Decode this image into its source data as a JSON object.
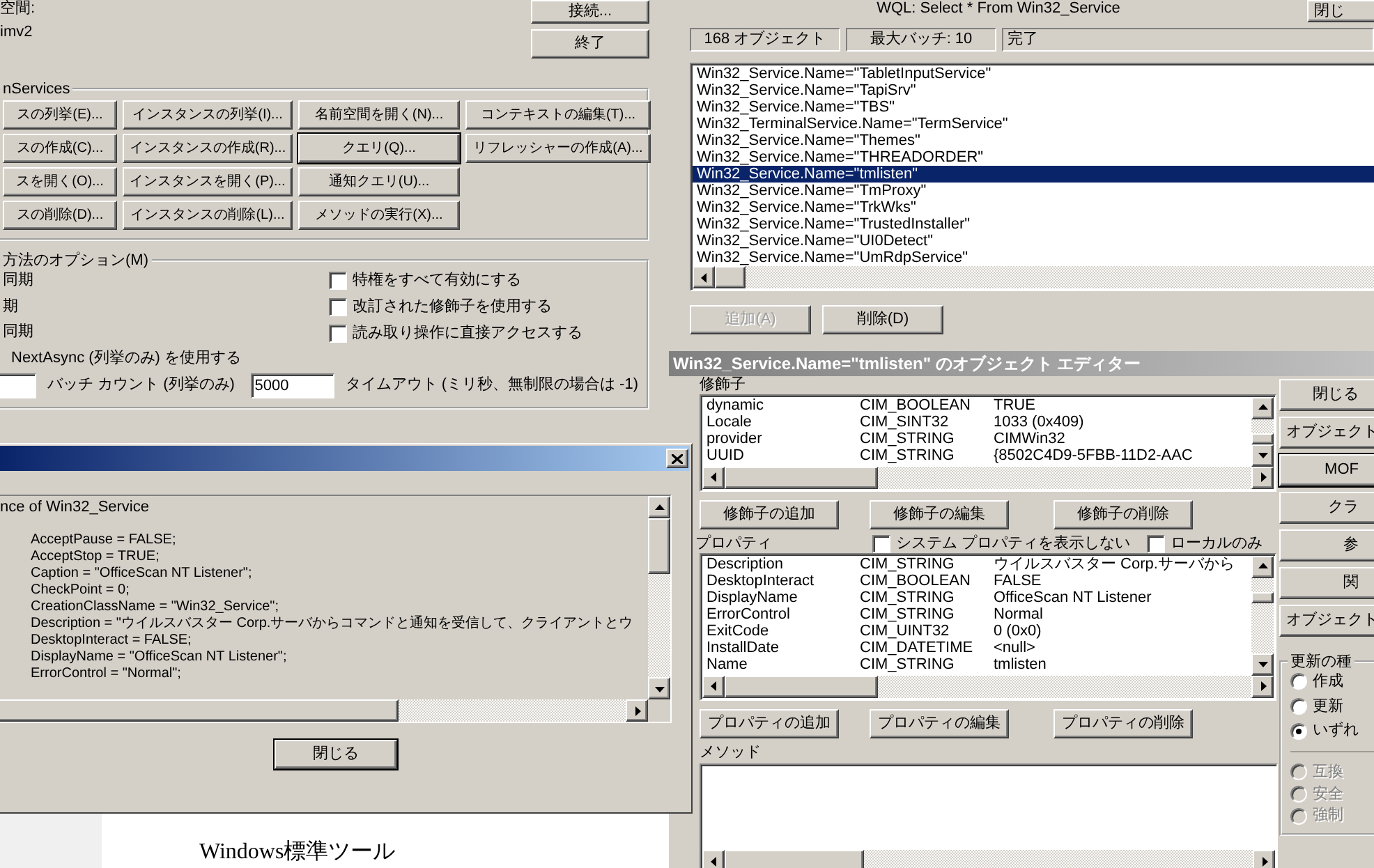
{
  "main_window": {
    "namespace_label": "空間:",
    "namespace": "imv2",
    "buttons": [
      {
        "label": "接続..."
      },
      {
        "label": "終了"
      }
    ],
    "services": {
      "title": "nServices",
      "buttons": [
        [
          {
            "label": "スの列挙(E)...",
            "default": false
          },
          {
            "label": "インスタンスの列挙(I)...",
            "default": false
          },
          {
            "label": "名前空間を開く(N)...",
            "default": false
          },
          {
            "label": "コンテキストの編集(T)...",
            "default": false
          }
        ],
        [
          {
            "label": "スの作成(C)...",
            "default": false
          },
          {
            "label": "インスタンスの作成(R)...",
            "default": false
          },
          {
            "label": "クエリ(Q)...",
            "default": true
          },
          {
            "label": "リフレッシャーの作成(A)...",
            "default": false
          }
        ],
        [
          {
            "label": "スを開く(O)...",
            "default": false
          },
          {
            "label": "インスタンスを開く(P)...",
            "default": false
          },
          {
            "label": "通知クエリ(U)...",
            "default": false
          }
        ],
        [
          {
            "label": "スの削除(D)...",
            "default": false
          },
          {
            "label": "インスタンスの削除(L)...",
            "default": false
          },
          {
            "label": "メソッドの実行(X)...",
            "default": false
          }
        ]
      ]
    },
    "options": {
      "title": "方法のオプション(M)",
      "modes": [
        "同期",
        "期",
        "同期"
      ],
      "next_async": "NextAsync (列挙のみ) を使用する",
      "checkboxes": [
        {
          "label": "特権をすべて有効にする",
          "checked": false
        },
        {
          "label": "改訂された修飾子を使用する",
          "checked": false
        },
        {
          "label": "読み取り操作に直接アクセスする",
          "checked": false
        }
      ],
      "batch_count_label": "バッチ カウント (列挙のみ)",
      "timeout": "5000",
      "timeout_label": "タイムアウト (ミリ秒、無制限の場合は -1)"
    }
  },
  "query_window": {
    "query": "WQL: Select * From Win32_Service",
    "close_button": "閉じ",
    "status": [
      "168 オブジェクト",
      "最大バッチ: 10",
      "完了"
    ],
    "results": [
      {
        "text": "Win32_Service.Name=\"TabletInputService\"",
        "selected": false
      },
      {
        "text": "Win32_Service.Name=\"TapiSrv\"",
        "selected": false
      },
      {
        "text": "Win32_Service.Name=\"TBS\"",
        "selected": false
      },
      {
        "text": "Win32_TerminalService.Name=\"TermService\"",
        "selected": false
      },
      {
        "text": "Win32_Service.Name=\"Themes\"",
        "selected": false
      },
      {
        "text": "Win32_Service.Name=\"THREADORDER\"",
        "selected": false
      },
      {
        "text": "Win32_Service.Name=\"tmlisten\"",
        "selected": true
      },
      {
        "text": "Win32_Service.Name=\"TmProxy\"",
        "selected": false
      },
      {
        "text": "Win32_Service.Name=\"TrkWks\"",
        "selected": false
      },
      {
        "text": "Win32_Service.Name=\"TrustedInstaller\"",
        "selected": false
      },
      {
        "text": "Win32_Service.Name=\"UI0Detect\"",
        "selected": false
      },
      {
        "text": "Win32_Service.Name=\"UmRdpService\"",
        "selected": false
      }
    ],
    "buttons": [
      {
        "label": "追加(A)",
        "disabled": true
      },
      {
        "label": "削除(D)",
        "disabled": false
      }
    ]
  },
  "object_editor": {
    "title": "Win32_Service.Name=\"tmlisten\" のオブジェクト エディター",
    "active": false,
    "qualifiers_label": "修飾子",
    "qualifiers": [
      [
        "dynamic",
        "CIM_BOOLEAN",
        "TRUE"
      ],
      [
        "Locale",
        "CIM_SINT32",
        "1033 (0x409)"
      ],
      [
        "provider",
        "CIM_STRING",
        "CIMWin32"
      ],
      [
        "UUID",
        "CIM_STRING",
        "{8502C4D9-5FBB-11D2-AAC"
      ]
    ],
    "qualifier_buttons": [
      "修飾子の追加",
      "修飾子の編集",
      "修飾子の削除"
    ],
    "properties_label": "プロパティ",
    "property_options": [
      {
        "label": "システム プロパティを表示しない",
        "checked": false
      },
      {
        "label": "ローカルのみ",
        "checked": false
      }
    ],
    "properties": [
      [
        "Description",
        "CIM_STRING",
        "ウイルスバスター Corp.サーバから"
      ],
      [
        "DesktopInteract",
        "CIM_BOOLEAN",
        "FALSE"
      ],
      [
        "DisplayName",
        "CIM_STRING",
        "OfficeScan NT Listener"
      ],
      [
        "ErrorControl",
        "CIM_STRING",
        "Normal"
      ],
      [
        "ExitCode",
        "CIM_UINT32",
        "0 (0x0)"
      ],
      [
        "InstallDate",
        "CIM_DATETIME",
        "<null>"
      ],
      [
        "Name",
        "CIM_STRING",
        "tmlisten"
      ]
    ],
    "property_buttons": [
      "プロパティの追加",
      "プロパティの編集",
      "プロパティの削除"
    ],
    "methods_label": "メソッド",
    "side_buttons": [
      {
        "label": "閉じる",
        "default": false
      },
      {
        "label": "オブジェクト",
        "default": false
      },
      {
        "label": "MOF",
        "default": true
      },
      {
        "label": "クラ",
        "default": false
      },
      {
        "label": "参",
        "default": false
      },
      {
        "label": "関",
        "default": false
      },
      {
        "label": "オブジェクト",
        "default": false
      }
    ],
    "update_group": {
      "title": "更新の種",
      "radios": [
        {
          "label": "作成",
          "selected": false,
          "disabled": false
        },
        {
          "label": "更新",
          "selected": false,
          "disabled": false
        },
        {
          "label": "いずれ",
          "selected": true,
          "disabled": false
        }
      ],
      "mode_radios": [
        {
          "label": "互換",
          "selected": false,
          "disabled": true
        },
        {
          "label": "安全",
          "selected": false,
          "disabled": true
        },
        {
          "label": "強制",
          "selected": false,
          "disabled": true
        }
      ]
    }
  },
  "instance_dialog": {
    "active": true,
    "header": "nce of Win32_Service",
    "members": [
      "AcceptPause = FALSE;",
      "AcceptStop = TRUE;",
      "Caption = \"OfficeScan NT Listener\";",
      "CheckPoint = 0;",
      "CreationClassName = \"Win32_Service\";",
      "Description = \"ウイルスバスター Corp.サーバからコマンドと通知を受信して、クライアントとウ",
      "DesktopInteract = FALSE;",
      "DisplayName = \"OfficeScan NT Listener\";",
      "ErrorControl = \"Normal\";"
    ],
    "close_button": "閉じる"
  },
  "background_page": {
    "text": "Windows標準ツール"
  }
}
